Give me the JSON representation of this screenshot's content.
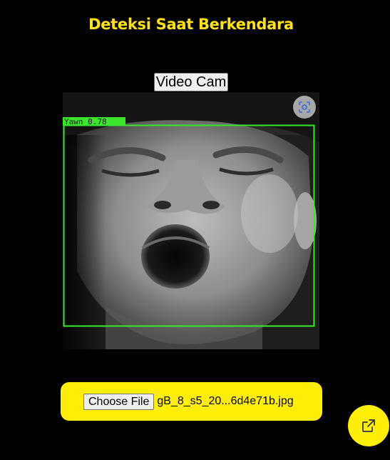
{
  "header": {
    "title": "Deteksi Saat Berkendara"
  },
  "controls": {
    "video_cam_label": "Video Cam"
  },
  "detection": {
    "label": "Yawn 0.78",
    "box_color": "#39e62a"
  },
  "upload": {
    "choose_label": "Choose File",
    "file_name": "gB_8_s5_20...6d4e71b.jpg"
  },
  "icons": {
    "lens": "google-lens-icon",
    "share": "open-external-icon"
  },
  "colors": {
    "background": "#000000",
    "accent": "#ffee07",
    "title": "#ffe40a"
  }
}
